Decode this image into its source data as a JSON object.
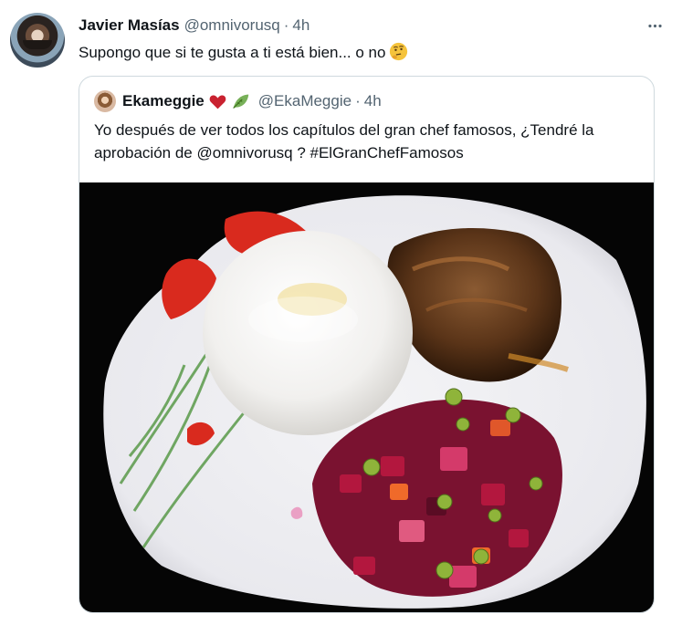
{
  "tweet": {
    "author_name": "Javier Masías",
    "author_handle": "@omnivorusq",
    "separator": "·",
    "time": "4h",
    "text": "Supongo que si te gusta a ti está bien... o no",
    "text_emoji": "thinking-face-emoji"
  },
  "quoted_tweet": {
    "author_name": "Ekameggie",
    "author_handle": "@EkaMeggie",
    "separator": "·",
    "time": "4h",
    "name_emojis": [
      "red-heart-emoji",
      "leaf-emoji"
    ],
    "text": "Yo después de ver todos los capítulos del gran chef famosos, ¿Tendré la aprobación de @omnivorusq ? #ElGranChefFamosos",
    "image": "food-plate-photo"
  },
  "colors": {
    "primary_text": "#0f1419",
    "secondary_text": "#536471",
    "border": "#cfd9de"
  }
}
